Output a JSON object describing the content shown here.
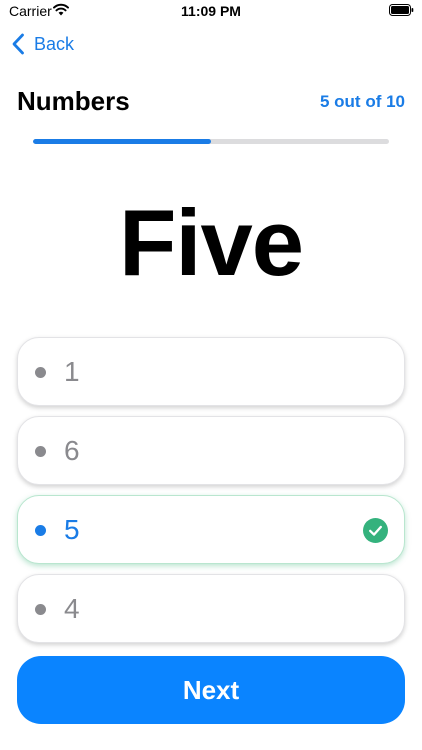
{
  "status_bar": {
    "carrier": "Carrier",
    "time": "11:09 PM",
    "wifi_icon": "wifi-icon",
    "battery_icon": "battery-icon"
  },
  "nav": {
    "back_label": "Back",
    "back_icon": "chevron-left-icon"
  },
  "header": {
    "title": "Numbers",
    "progress_text": "5 out of 10",
    "progress_current": 5,
    "progress_total": 10
  },
  "question": {
    "word": "Five"
  },
  "options": [
    {
      "label": "1",
      "selected": false,
      "correct": false
    },
    {
      "label": "6",
      "selected": false,
      "correct": false
    },
    {
      "label": "5",
      "selected": true,
      "correct": true
    },
    {
      "label": "4",
      "selected": false,
      "correct": false
    }
  ],
  "footer": {
    "next_label": "Next"
  },
  "colors": {
    "accent": "#1a7ce6",
    "button": "#0a84ff",
    "correct": "#34b27d",
    "muted": "#8a8a8e"
  }
}
